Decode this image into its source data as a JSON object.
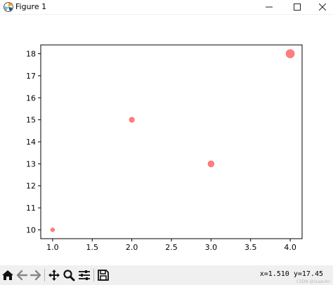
{
  "window": {
    "title": "Figure 1",
    "icons": {
      "app": "matplotlib-figure-icon",
      "minimize": "minimize-icon",
      "maximize": "maximize-icon",
      "close": "close-icon"
    }
  },
  "chart_data": {
    "type": "scatter",
    "x": [
      1.0,
      2.0,
      3.0,
      4.0
    ],
    "y": [
      10,
      15,
      13,
      18
    ],
    "sizes": [
      1,
      2,
      3,
      6
    ],
    "color": "#ff0000",
    "alpha": 0.5,
    "title": "",
    "xlabel": "",
    "ylabel": "",
    "xlim": [
      0.85,
      4.15
    ],
    "ylim": [
      9.6,
      18.4
    ],
    "xticks": [
      1.0,
      1.5,
      2.0,
      2.5,
      3.0,
      3.5,
      4.0
    ],
    "xtick_labels": [
      "1.0",
      "1.5",
      "2.0",
      "2.5",
      "3.0",
      "3.5",
      "4.0"
    ],
    "yticks": [
      10,
      11,
      12,
      13,
      14,
      15,
      16,
      17,
      18
    ],
    "ytick_labels": [
      "10",
      "11",
      "12",
      "13",
      "14",
      "15",
      "16",
      "17",
      "18"
    ],
    "grid": false
  },
  "toolbar": {
    "buttons": [
      {
        "name": "home-button",
        "icon": "home-icon"
      },
      {
        "name": "back-button",
        "icon": "arrow-left-icon"
      },
      {
        "name": "forward-button",
        "icon": "arrow-right-icon"
      },
      {
        "name": "pan-button",
        "icon": "move-icon"
      },
      {
        "name": "zoom-button",
        "icon": "zoom-icon"
      },
      {
        "name": "configure-subplots-button",
        "icon": "sliders-icon"
      },
      {
        "name": "save-button",
        "icon": "save-icon"
      }
    ],
    "coordinates": "x=1.510  y=17.45"
  },
  "watermark": "CSDN @IsaacAn"
}
